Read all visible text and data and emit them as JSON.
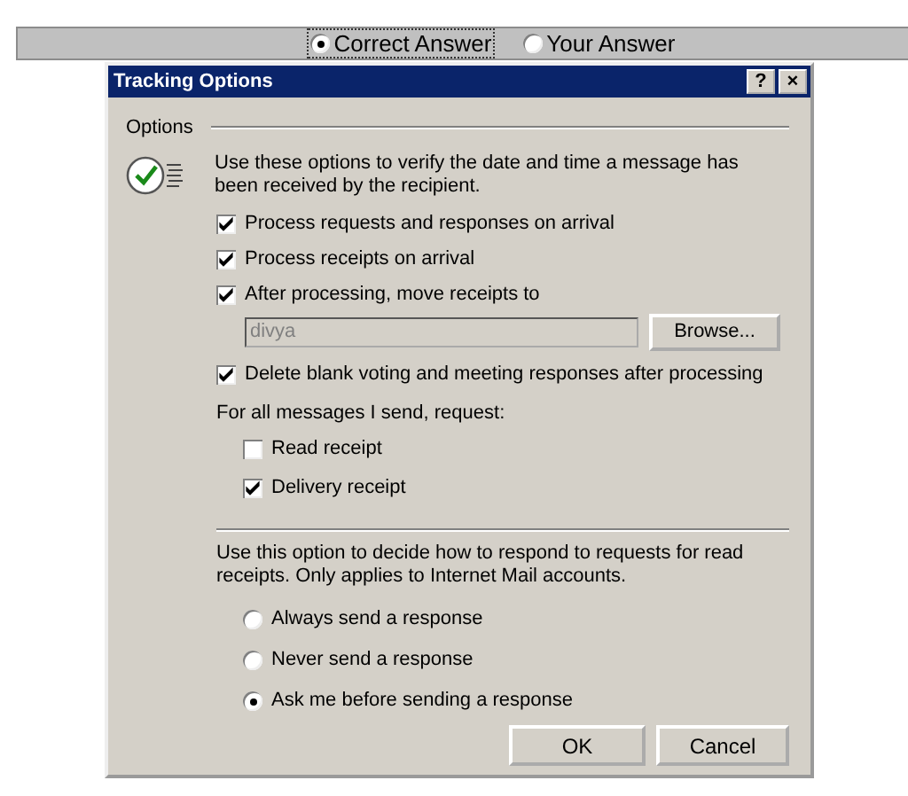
{
  "answer_toggle": [
    {
      "label": "Correct Answer",
      "selected": true
    },
    {
      "label": "Your Answer",
      "selected": false
    }
  ],
  "dialog": {
    "title": "Tracking Options",
    "title_buttons": [
      "?",
      "×"
    ],
    "group_label": "Options",
    "description": "Use these options to verify the date and time a message has been received by the recipient.",
    "checks": [
      {
        "label": "Process requests and responses on arrival",
        "checked": true
      },
      {
        "label": "Process receipts on arrival",
        "checked": true
      },
      {
        "label": "After processing, move receipts to",
        "checked": true
      }
    ],
    "folder_field": {
      "value": "divya",
      "disabled": true
    },
    "browse_button": "Browse...",
    "delete_blank": {
      "label": "Delete blank voting and meeting responses after processing",
      "checked": true
    },
    "request_label": "For all messages I send, request:",
    "request_checks": [
      {
        "label": "Read receipt",
        "checked": false
      },
      {
        "label": "Delivery receipt",
        "checked": true
      }
    ],
    "response_description": "Use this option to decide how to respond to requests for read receipts. Only applies to Internet Mail accounts.",
    "responses": [
      {
        "label": "Always send a response",
        "selected": false
      },
      {
        "label": "Never send a response",
        "selected": false
      },
      {
        "label": "Ask me before sending a response",
        "selected": true
      }
    ],
    "buttons": [
      "OK",
      "Cancel"
    ]
  }
}
